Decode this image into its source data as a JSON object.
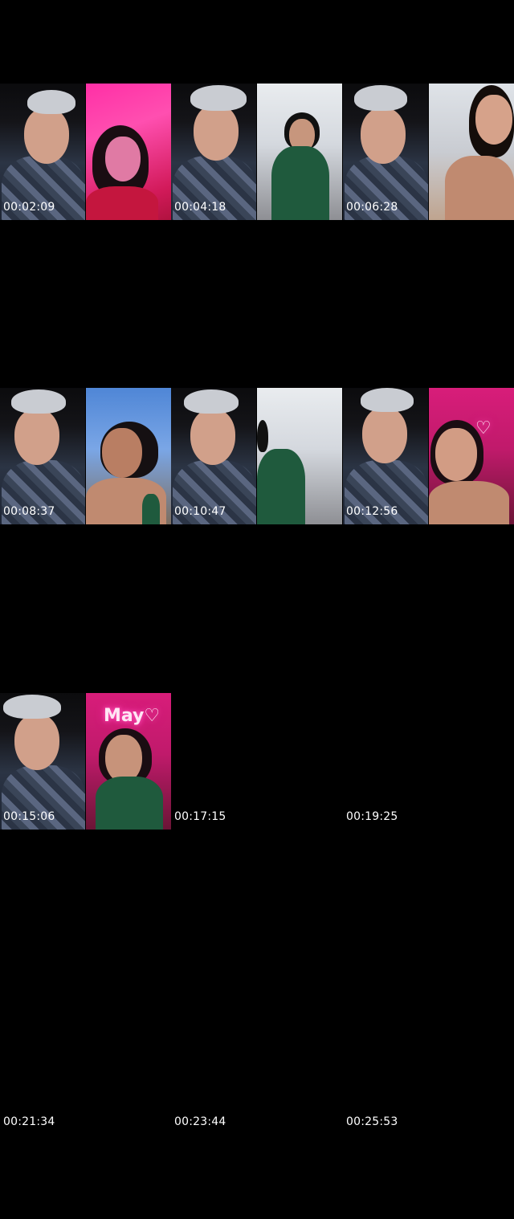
{
  "timestamps": [
    "00:02:09",
    "00:04:18",
    "00:06:28",
    "00:08:37",
    "00:10:47",
    "00:12:56",
    "00:15:06",
    "00:17:15",
    "00:19:25",
    "00:21:34",
    "00:23:44",
    "00:25:53"
  ],
  "neon_sign_text": "May♡",
  "neon_heart": "♡"
}
